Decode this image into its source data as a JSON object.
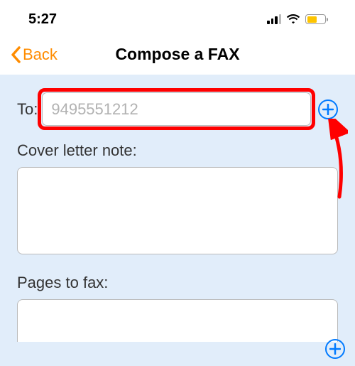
{
  "status": {
    "time": "5:27"
  },
  "nav": {
    "back_label": "Back",
    "title": "Compose a FAX"
  },
  "form": {
    "to_label": "To:",
    "to_placeholder": "9495551212",
    "to_value": "",
    "cover_label": "Cover letter note:",
    "cover_value": "",
    "pages_label": "Pages to fax:"
  },
  "colors": {
    "accent_orange": "#ff8c00",
    "accent_blue": "#007aff",
    "highlight_red": "#ff0000",
    "background_blue": "#e1edfa",
    "battery_yellow": "#fdc400"
  }
}
